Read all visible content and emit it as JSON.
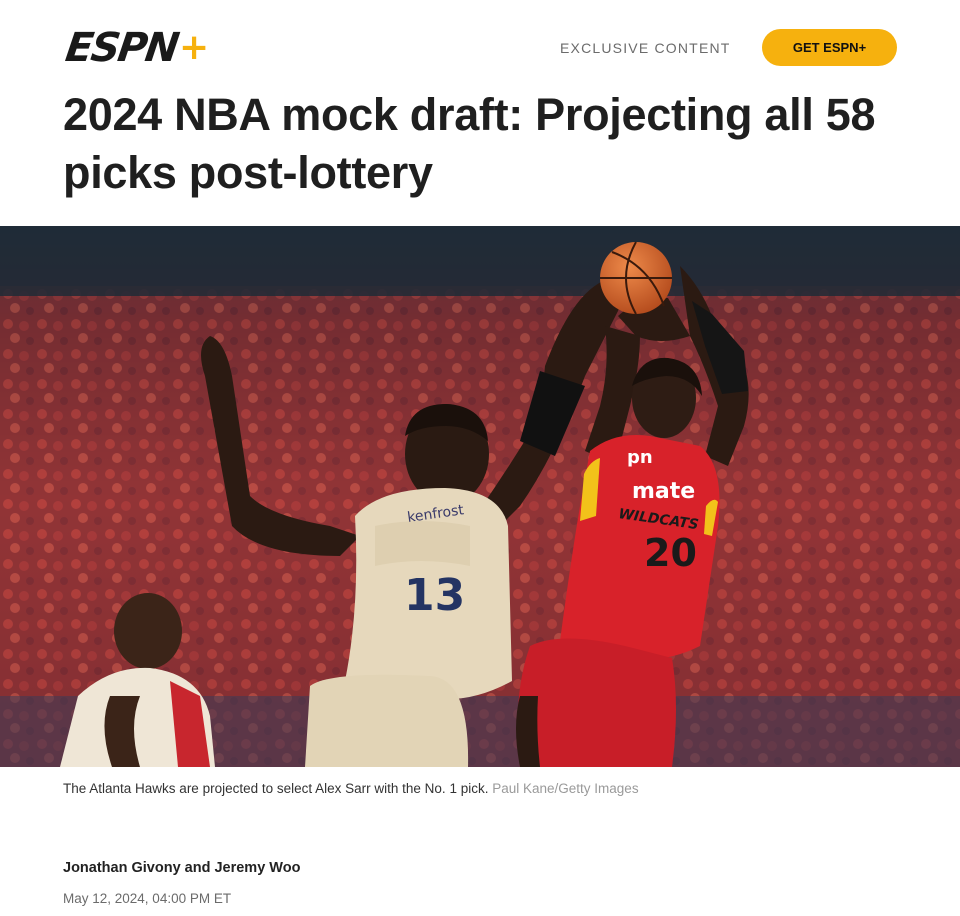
{
  "header": {
    "logo_text": "ESPN",
    "logo_plus": "+",
    "exclusive_label": "EXCLUSIVE CONTENT",
    "cta_label": "GET ESPN+"
  },
  "article": {
    "headline": "2024 NBA mock draft: Projecting all 58 picks post-lottery",
    "caption": "The Atlanta Hawks are projected to select Alex Sarr with the No. 1 pick.",
    "photo_credit": "Paul Kane/Getty Images",
    "authors": "Jonathan Givony and Jeremy Woo",
    "date": "May 12, 2024, 04:00 PM ET"
  },
  "photo": {
    "defender_jersey_number": "13",
    "defender_sponsor": "kenfrost",
    "shooter_jersey_number": "20",
    "shooter_sponsor": "mate",
    "shooter_team": "WILDCATS",
    "shooter_chest_logo": "pn"
  },
  "colors": {
    "accent": "#f6b10e",
    "headline": "#1f1f1f",
    "muted": "#6b6b6b",
    "jersey_red": "#d8222a",
    "jersey_cream": "#e8dcc4"
  }
}
